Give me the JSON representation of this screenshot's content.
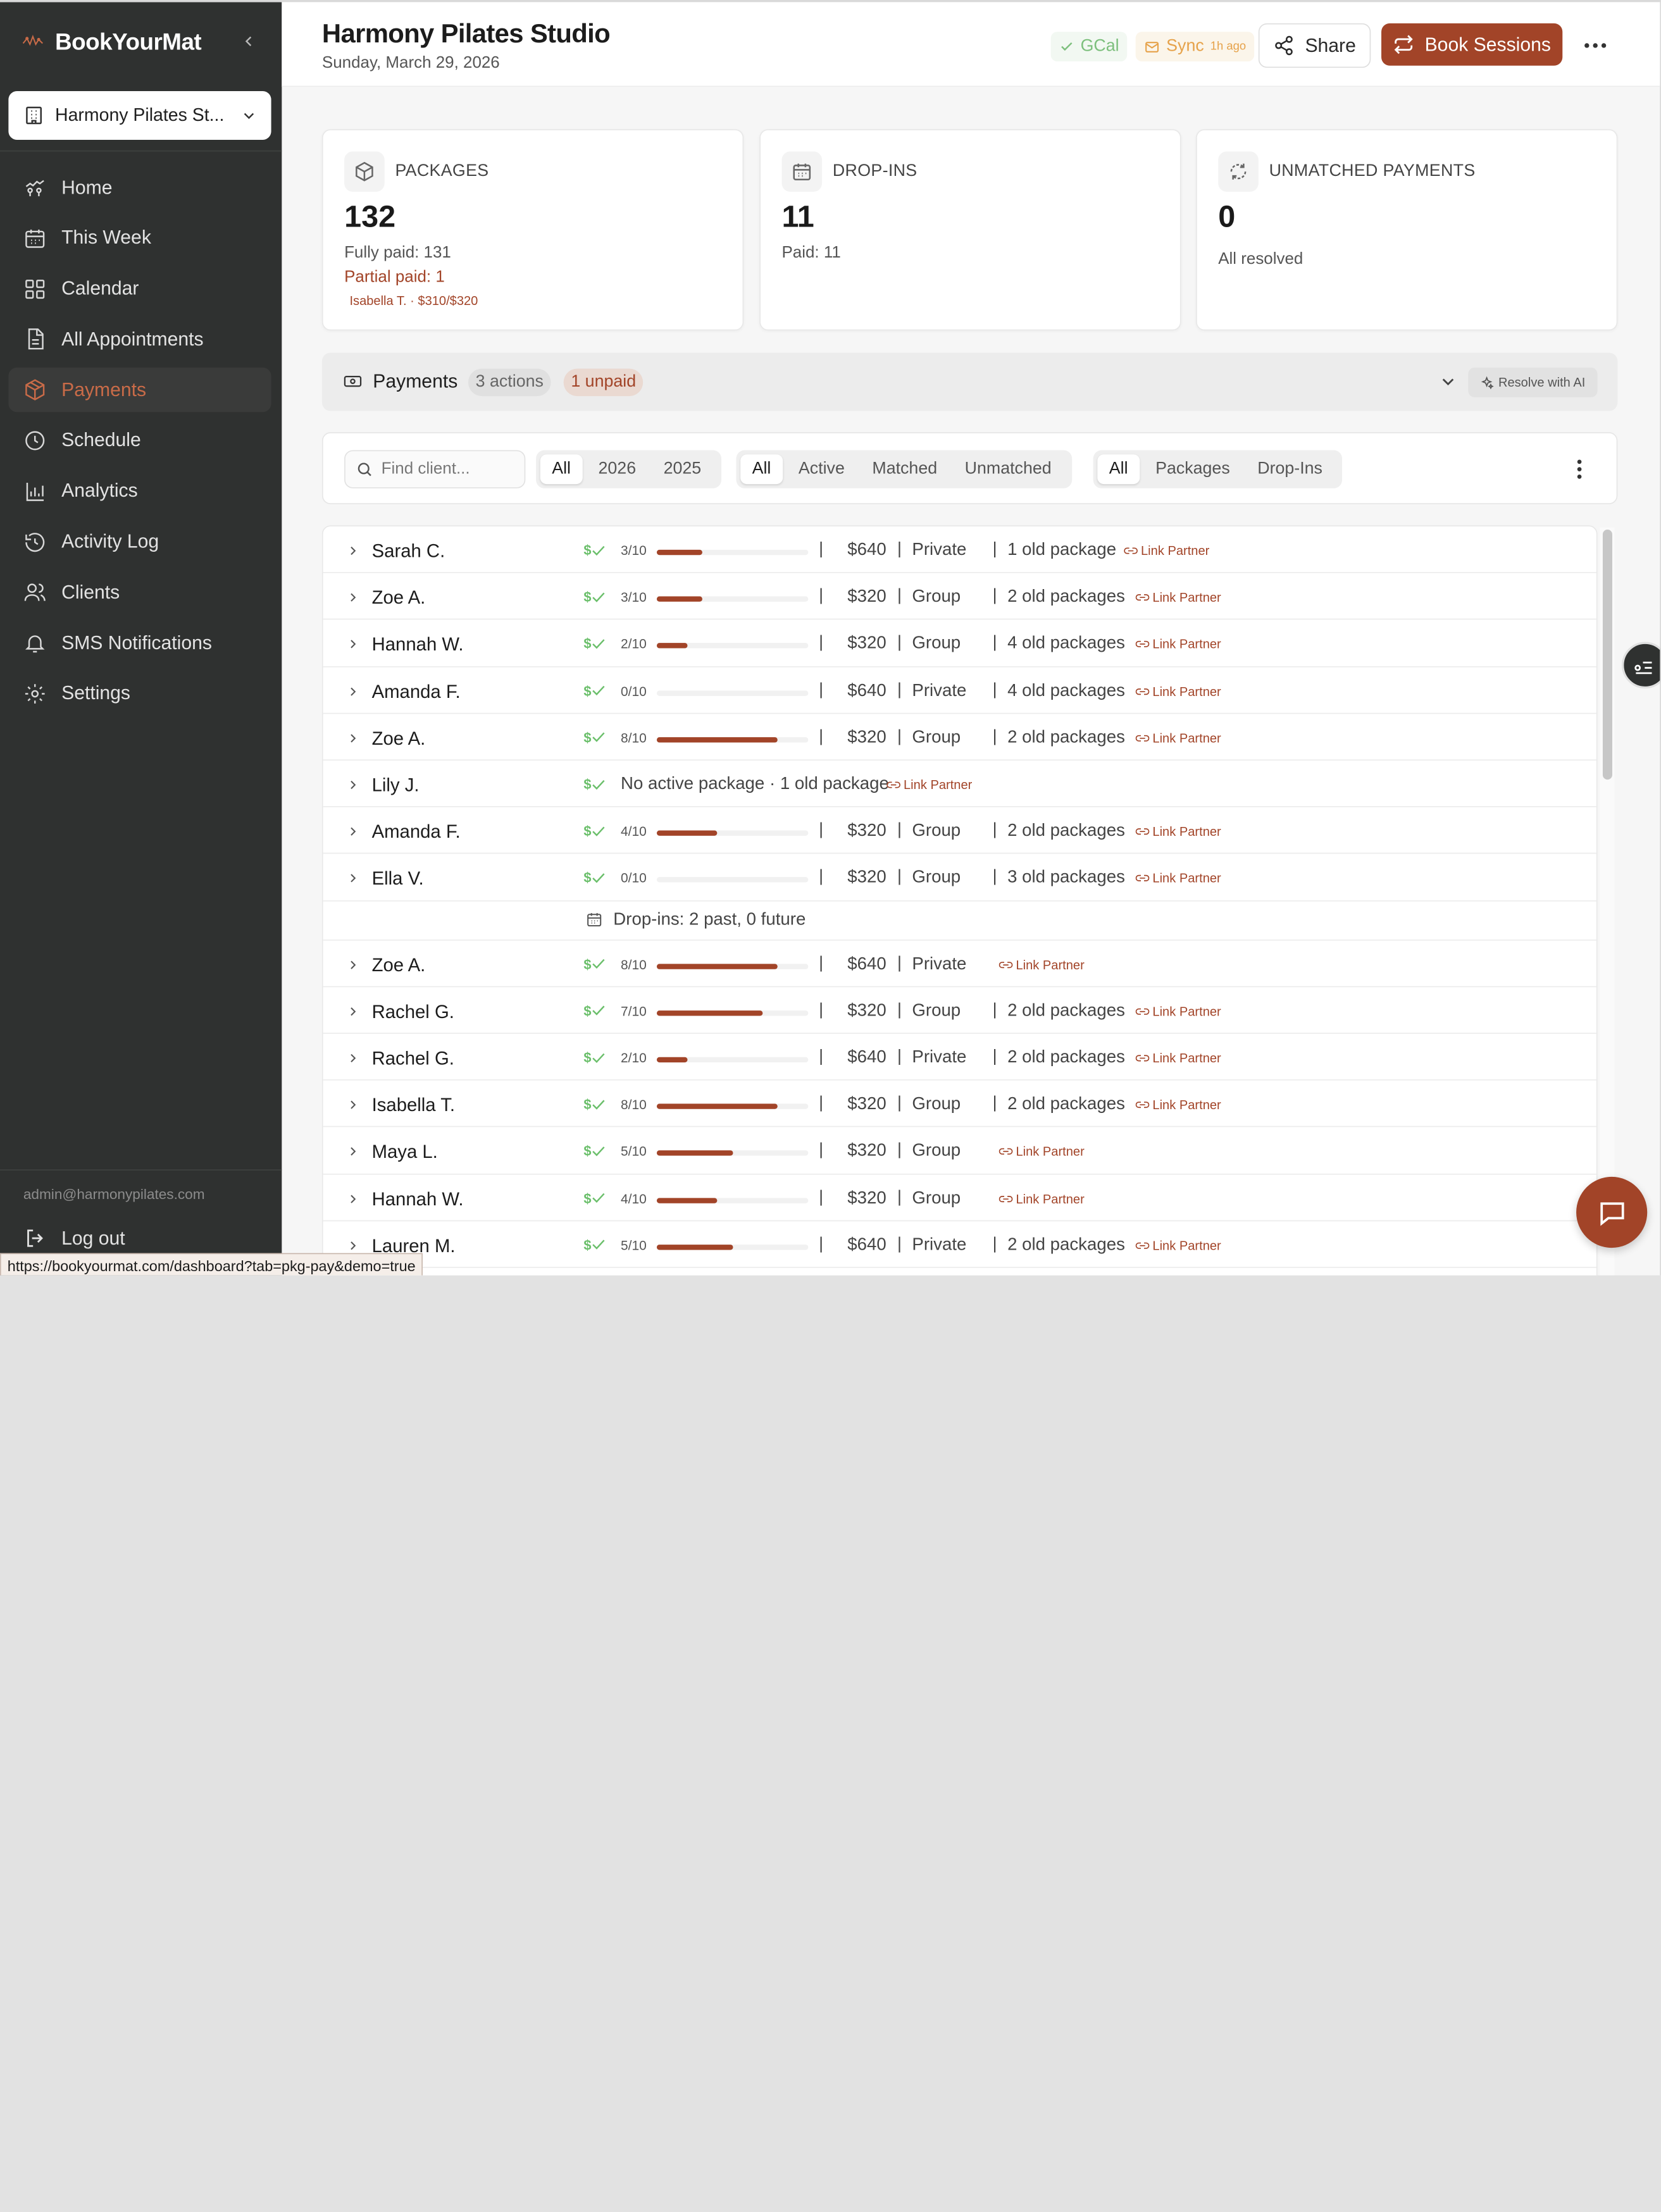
{
  "app": {
    "name": "BookYourMat",
    "studio_selector": "Harmony Pilates St...",
    "admin_email": "admin@harmonypilates.com",
    "logout_label": "Log out",
    "status_url": "https://bookyourmat.com/dashboard?tab=pkg-pay&demo=true"
  },
  "colors": {
    "accent": "#a24428",
    "sidebar_bg": "#2f3130",
    "paid_green": "#6bbf6b",
    "sync_orange": "#e6a24a"
  },
  "nav": [
    {
      "label": "Home",
      "icon": "home-icon"
    },
    {
      "label": "This Week",
      "icon": "calendar-week-icon"
    },
    {
      "label": "Calendar",
      "icon": "calendar-grid-icon"
    },
    {
      "label": "All Appointments",
      "icon": "document-icon"
    },
    {
      "label": "Payments",
      "icon": "package-icon",
      "active": true
    },
    {
      "label": "Schedule",
      "icon": "clock-icon"
    },
    {
      "label": "Analytics",
      "icon": "bar-chart-icon"
    },
    {
      "label": "Activity Log",
      "icon": "history-icon"
    },
    {
      "label": "Clients",
      "icon": "users-icon"
    },
    {
      "label": "SMS Notifications",
      "icon": "bell-icon"
    },
    {
      "label": "Settings",
      "icon": "gear-icon"
    }
  ],
  "header": {
    "title": "Harmony Pilates Studio",
    "date": "Sunday, March 29, 2026",
    "gcal": "GCal",
    "sync": "Sync",
    "sync_ago": "1h ago",
    "share": "Share",
    "book": "Book Sessions"
  },
  "stats": {
    "packages": {
      "label": "PACKAGES",
      "value": "132",
      "line1": "Fully paid: 131",
      "line2": "Partial paid: 1",
      "line3": "Isabella T. · $310/$320"
    },
    "dropins": {
      "label": "DROP-INS",
      "value": "11",
      "line1": "Paid: 11"
    },
    "unmatched": {
      "label": "UNMATCHED PAYMENTS",
      "value": "0",
      "line1": "All resolved"
    }
  },
  "payments_bar": {
    "title": "Payments",
    "actions": "3 actions",
    "unpaid": "1 unpaid",
    "resolve": "Resolve with AI"
  },
  "filters": {
    "search_placeholder": "Find client...",
    "year": [
      "All",
      "2026",
      "2025"
    ],
    "status": [
      "All",
      "Active",
      "Matched",
      "Unmatched"
    ],
    "type": [
      "All",
      "Packages",
      "Drop-Ins"
    ]
  },
  "rows": [
    {
      "name": "Sarah C.",
      "paid": "$",
      "count": "3/10",
      "progress": 0.3,
      "price": "$640",
      "type": "Private",
      "old": "1 old package",
      "link": "Link Partner"
    },
    {
      "name": "Zoe A.",
      "paid": "$",
      "count": "3/10",
      "progress": 0.3,
      "price": "$320",
      "type": "Group",
      "old": "2 old packages",
      "link": "Link Partner"
    },
    {
      "name": "Hannah W.",
      "paid": "$",
      "count": "2/10",
      "progress": 0.2,
      "price": "$320",
      "type": "Group",
      "old": "4 old packages",
      "link": "Link Partner"
    },
    {
      "name": "Amanda F.",
      "paid": "$",
      "count": "0/10",
      "progress": 0.0,
      "price": "$640",
      "type": "Private",
      "old": "4 old packages",
      "link": "Link Partner"
    },
    {
      "name": "Zoe A.",
      "paid": "$",
      "count": "8/10",
      "progress": 0.8,
      "price": "$320",
      "type": "Group",
      "old": "2 old packages",
      "link": "Link Partner"
    },
    {
      "name": "Lily J.",
      "paid": "$",
      "no_active": "No active package · 1 old package",
      "link": "Link Partner"
    },
    {
      "name": "Amanda F.",
      "paid": "$",
      "count": "4/10",
      "progress": 0.4,
      "price": "$320",
      "type": "Group",
      "old": "2 old packages",
      "link": "Link Partner"
    },
    {
      "name": "Ella V.",
      "paid": "$",
      "count": "0/10",
      "progress": 0.0,
      "price": "$320",
      "type": "Group",
      "old": "3 old packages",
      "link": "Link Partner"
    },
    {
      "dropins": "Drop-ins: 2 past, 0 future"
    },
    {
      "name": "Zoe A.",
      "paid": "$",
      "count": "8/10",
      "progress": 0.8,
      "price": "$640",
      "type": "Private",
      "link": "Link Partner"
    },
    {
      "name": "Rachel G.",
      "paid": "$",
      "count": "7/10",
      "progress": 0.7,
      "price": "$320",
      "type": "Group",
      "old": "2 old packages",
      "link": "Link Partner"
    },
    {
      "name": "Rachel G.",
      "paid": "$",
      "count": "2/10",
      "progress": 0.2,
      "price": "$640",
      "type": "Private",
      "old": "2 old packages",
      "link": "Link Partner"
    },
    {
      "name": "Isabella T.",
      "paid": "$",
      "count": "8/10",
      "progress": 0.8,
      "price": "$320",
      "type": "Group",
      "old": "2 old packages",
      "link": "Link Partner"
    },
    {
      "name": "Maya L.",
      "paid": "$",
      "count": "5/10",
      "progress": 0.5,
      "price": "$320",
      "type": "Group",
      "link": "Link Partner"
    },
    {
      "name": "Hannah W.",
      "paid": "$",
      "count": "4/10",
      "progress": 0.4,
      "price": "$320",
      "type": "Group",
      "link": "Link Partner"
    },
    {
      "name": "Lauren M.",
      "paid": "$",
      "count": "5/10",
      "progress": 0.5,
      "price": "$640",
      "type": "Private",
      "old": "2 old packages",
      "link": "Link Partner"
    }
  ]
}
